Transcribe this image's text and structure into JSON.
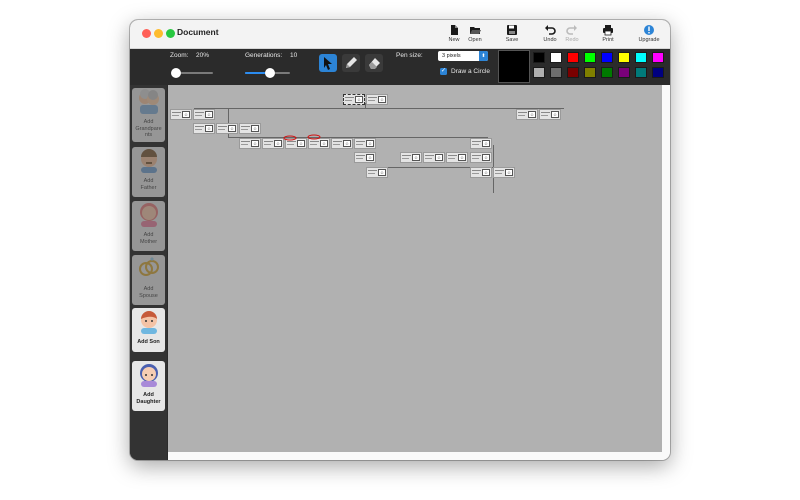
{
  "window": {
    "title": "Document"
  },
  "titlebar_buttons": [
    {
      "label": "New",
      "icon": "new-document-icon",
      "enabled": true
    },
    {
      "label": "Open",
      "icon": "folder-icon",
      "enabled": true
    },
    {
      "label": "Save",
      "icon": "floppy-disk-icon",
      "enabled": true
    },
    {
      "label": "Undo",
      "icon": "undo-icon",
      "enabled": true
    },
    {
      "label": "Redo",
      "icon": "redo-icon",
      "enabled": false
    },
    {
      "label": "Print",
      "icon": "printer-icon",
      "enabled": true
    },
    {
      "label": "Upgrade",
      "icon": "exclamation-badge-icon",
      "enabled": true
    }
  ],
  "toolbar": {
    "zoom_label": "Zoom:",
    "zoom_value": "20%",
    "zoom_level": 0.0,
    "generations_label": "Generations:",
    "generations_value": "10",
    "generations_level": 0.55,
    "tools": [
      {
        "name": "pointer",
        "icon": "cursor-arrow-icon",
        "active": true
      },
      {
        "name": "pen",
        "icon": "pencil-icon",
        "active": false
      },
      {
        "name": "eraser",
        "icon": "eraser-icon",
        "active": false
      }
    ],
    "pen_size_label": "Pen size:",
    "pen_size_value": "3 pixels",
    "draw_circle_label": "Draw a Circle",
    "draw_circle_checked": true,
    "current_color": "#000000",
    "palette_top": [
      "#000000",
      "#ffffff",
      "#ff0000",
      "#00ff00",
      "#0000ff",
      "#ffff00",
      "#00ffff",
      "#ff00ff"
    ],
    "palette_bottom": [
      "#b0b0b0",
      "#6e6e6e",
      "#7a0000",
      "#808000",
      "#007a00",
      "#7a007a",
      "#007a7a",
      "#000080"
    ]
  },
  "sidebar": {
    "items": [
      {
        "label": "Add Grandparents",
        "lines": [
          "Add",
          "Grandpare",
          "nts"
        ],
        "icon": "grandparents-icon",
        "enabled": false
      },
      {
        "label": "Add Father",
        "lines": [
          "Add",
          "Father"
        ],
        "icon": "father-icon",
        "enabled": false
      },
      {
        "label": "Add Mother",
        "lines": [
          "Add",
          "Mother"
        ],
        "icon": "mother-icon",
        "enabled": false
      },
      {
        "label": "Add Spouse",
        "lines": [
          "Add",
          "Spouse"
        ],
        "icon": "rings-icon",
        "enabled": false
      },
      {
        "label": "Add Son",
        "lines": [
          "Add Son"
        ],
        "icon": "son-icon",
        "enabled": true
      },
      {
        "label": "Add Daughter",
        "lines": [
          "Add",
          "Daughter"
        ],
        "icon": "daughter-icon",
        "enabled": true
      }
    ]
  }
}
